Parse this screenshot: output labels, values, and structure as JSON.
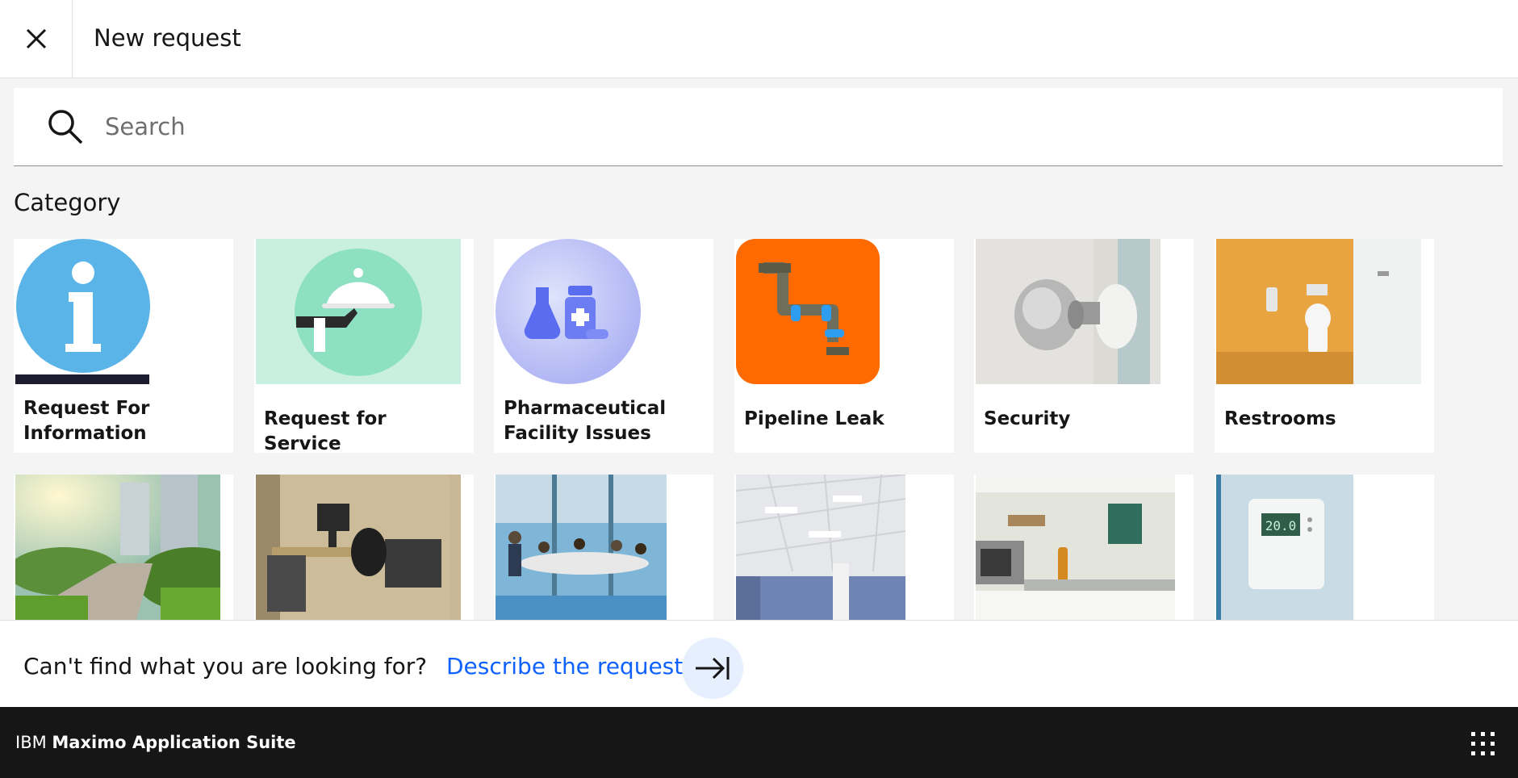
{
  "header": {
    "title": "New request",
    "close_icon": "close-icon"
  },
  "search": {
    "placeholder": "Search",
    "value": "",
    "icon": "search-icon"
  },
  "category": {
    "title": "Category",
    "row1": [
      {
        "label": "Request For Information",
        "image": "information-icon"
      },
      {
        "label": "Request for Service",
        "image": "service-cloche-icon"
      },
      {
        "label": "Pharmaceutical Facility Issues",
        "image": "pharmacy-flask-icon"
      },
      {
        "label": "Pipeline Leak",
        "image": "pipeline-icon"
      },
      {
        "label": "Security",
        "image": "door-knob-photo"
      },
      {
        "label": "Restrooms",
        "image": "restroom-photo"
      }
    ],
    "row2": [
      {
        "image": "garden-photo"
      },
      {
        "image": "office-desk-photo"
      },
      {
        "image": "meeting-room-photo"
      },
      {
        "image": "ceiling-lights-photo"
      },
      {
        "image": "kitchen-photo"
      },
      {
        "image": "thermostat-photo"
      }
    ],
    "thermostat_reading": "20.0"
  },
  "footer": {
    "prompt": "Can't find what you are looking for?",
    "link_label": "Describe the request",
    "arrow_icon": "arrow-right-to-line-icon"
  },
  "shell": {
    "brand_prefix": "IBM",
    "brand_product": "Maximo Application Suite",
    "apps_icon": "app-switcher-icon"
  },
  "colors": {
    "link": "#0f62fe",
    "shell": "#161616",
    "background": "#f4f4f4"
  }
}
